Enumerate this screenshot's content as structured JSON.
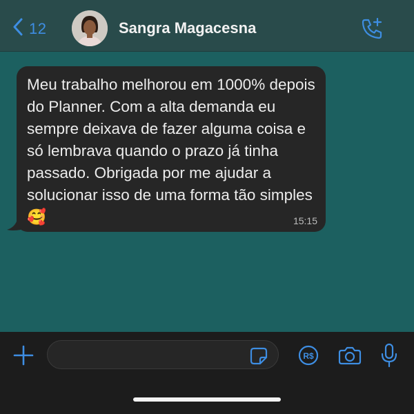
{
  "header": {
    "back_count": "12",
    "contact_name": "Sangra Magacesna",
    "icons": {
      "back": "chevron-left-icon",
      "call": "add-call-icon"
    }
  },
  "message": {
    "text": "Meu trabalho melhorou em 1000% depois do Planner. Com a alta demanda eu sempre deixava de fazer alguma coisa e só lembrava quando o prazo já tinha passado. Obrigada por me ajudar a solucionar isso de uma forma tão simples🥰",
    "time": "15:15"
  },
  "composer": {
    "input_value": "",
    "icons": [
      "plus-icon",
      "sticker-icon",
      "payment-icon",
      "camera-icon",
      "microphone-icon"
    ],
    "payment_label": "R$"
  },
  "colors": {
    "accent": "#3e8ee3",
    "header_bg": "#294b4b",
    "chat_bg": "#1c6060",
    "bubble_bg": "#262626",
    "composer_bg": "#1c1c1c"
  }
}
